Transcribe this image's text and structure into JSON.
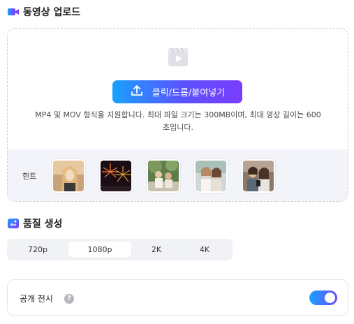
{
  "upload_section": {
    "title": "동영상 업로드",
    "icon": "video-camera-icon",
    "upload_button_label": "클릭/드롭/붙여넣기",
    "upload_button_icon": "upload-icon",
    "info_line1": "MP4 및 MOV 형식을 지원합니다. 최대 파일 크기는 300MB이며, 최대 영상 길이는 600",
    "info_line2": "초입니다.",
    "hint_label": "힌트",
    "hint_thumbnails": [
      {
        "name": "woman-portrait-thumbnail"
      },
      {
        "name": "fireworks-thumbnail"
      },
      {
        "name": "people-outdoors-thumbnail"
      },
      {
        "name": "two-women-thumbnail"
      },
      {
        "name": "couple-with-phone-thumbnail"
      }
    ]
  },
  "quality_section": {
    "title": "품질 생성",
    "icon": "sparkle-image-icon",
    "options": [
      "720p",
      "1080p",
      "2K",
      "4K"
    ],
    "selected": "1080p"
  },
  "public_section": {
    "label": "공개 전시",
    "help_icon": "question-icon",
    "help_glyph": "?",
    "toggle_on": true
  },
  "colors": {
    "accent_start": "#1aa1ff",
    "accent_end": "#7a3cff"
  }
}
